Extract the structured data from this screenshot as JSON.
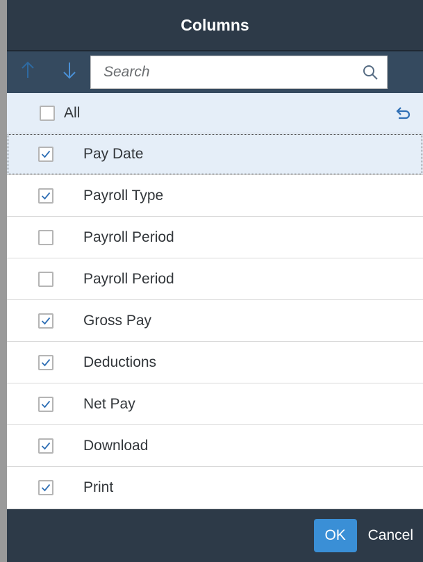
{
  "dialog": {
    "title": "Columns"
  },
  "toolbar": {
    "move_up_icon": "arrow-up-icon",
    "move_down_icon": "arrow-down-icon",
    "search_placeholder": "Search",
    "search_value": "",
    "search_icon": "search-icon"
  },
  "select_all": {
    "label": "All",
    "checked": false,
    "reset_icon": "undo-icon"
  },
  "columns": [
    {
      "label": "Pay Date",
      "checked": true,
      "selected": true
    },
    {
      "label": "Payroll Type",
      "checked": true,
      "selected": false
    },
    {
      "label": "Payroll Period",
      "checked": false,
      "selected": false
    },
    {
      "label": "Payroll Period",
      "checked": false,
      "selected": false
    },
    {
      "label": "Gross Pay",
      "checked": true,
      "selected": false
    },
    {
      "label": "Deductions",
      "checked": true,
      "selected": false
    },
    {
      "label": "Net Pay",
      "checked": true,
      "selected": false
    },
    {
      "label": "Download",
      "checked": true,
      "selected": false
    },
    {
      "label": "Print",
      "checked": true,
      "selected": false
    }
  ],
  "footer": {
    "ok_label": "OK",
    "cancel_label": "Cancel"
  },
  "colors": {
    "header_bg": "#2d3a48",
    "toolbar_bg": "#354a5f",
    "selection_bg": "#e5eef8",
    "accent": "#3a8fd6",
    "check": "#2f6fb5"
  }
}
